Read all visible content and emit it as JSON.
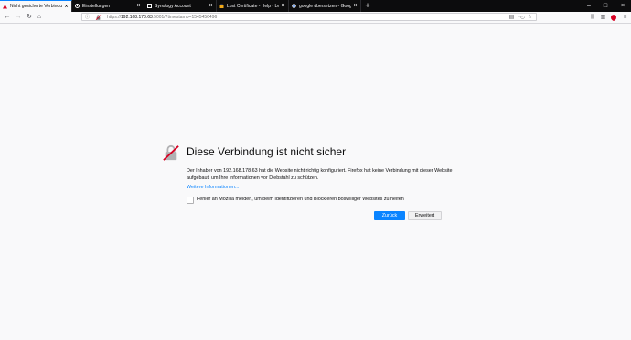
{
  "tabs": [
    {
      "label": "Nicht gesicherte Verbindung",
      "icon": "warning-icon",
      "active": true
    },
    {
      "label": "Einstellungen",
      "icon": "gear-icon",
      "active": false
    },
    {
      "label": "Synology Account",
      "icon": "synology-icon",
      "active": false
    },
    {
      "label": "Lost Certificate - Help - Let's E",
      "icon": "letsencrypt-icon",
      "active": false
    },
    {
      "label": "google übersetzen - Google-Su",
      "icon": "google-icon",
      "active": false
    }
  ],
  "url": {
    "protocol": "https://",
    "host": "192.168.178.63",
    "rest": ":5001/?timestamp=1545456496"
  },
  "error": {
    "title": "Diese Verbindung ist nicht sicher",
    "description": "Der Inhaber von 192.168.178.63 hat die Website nicht richtig konfiguriert. Firefox hat keine Verbindung mit dieser Website aufgebaut, um Ihre Informationen vor Diebstahl zu schützen.",
    "more_link": "Weitere Informationen...",
    "checkbox_label": "Fehler an Mozilla melden, um beim Identifizieren und Blockieren böswilliger Websites zu helfen",
    "back_button": "Zurück",
    "advanced_button": "Erweitert"
  },
  "colors": {
    "accent": "#0a84ff",
    "tabbar": "#0c0c0d",
    "background": "#f9f9fa"
  }
}
